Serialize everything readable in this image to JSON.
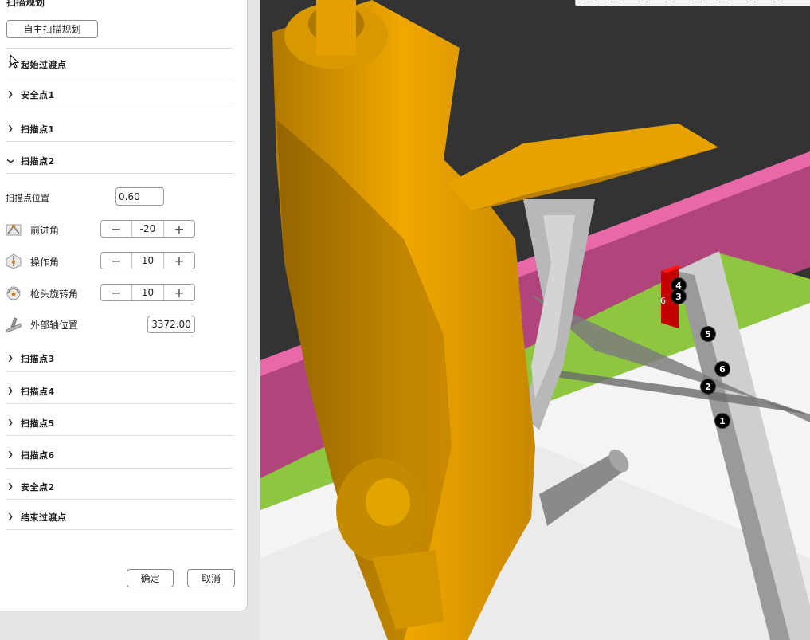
{
  "panel": {
    "title": "扫描规划",
    "auto_button": "自主扫描规划",
    "sections_top": [
      "起始过渡点",
      "安全点1",
      "扫描点1",
      "扫描点2"
    ],
    "scan_pos": {
      "label": "扫描点位置",
      "value": "0.60"
    },
    "advance_angle": {
      "label": "前进角",
      "value": "-20"
    },
    "work_angle": {
      "label": "操作角",
      "value": "10"
    },
    "torch_rotation": {
      "label": "枪头旋转角",
      "value": "10"
    },
    "external_axis": {
      "label": "外部轴位置",
      "value": "3372.00"
    },
    "sections_bottom": [
      "扫描点3",
      "扫描点4",
      "扫描点5",
      "扫描点6",
      "安全点2",
      "结束过渡点"
    ],
    "confirm": "确定",
    "cancel": "取消",
    "stepper_minus": "−",
    "stepper_plus": "+"
  },
  "viewport": {
    "markers": [
      "4",
      "3",
      "5",
      "6",
      "2",
      "1"
    ],
    "side_label": "6",
    "colors": {
      "robot": "#f0a800",
      "magenta": "#d9559a",
      "green": "#8ec63f",
      "red": "#c40000",
      "background": "#333333"
    }
  }
}
